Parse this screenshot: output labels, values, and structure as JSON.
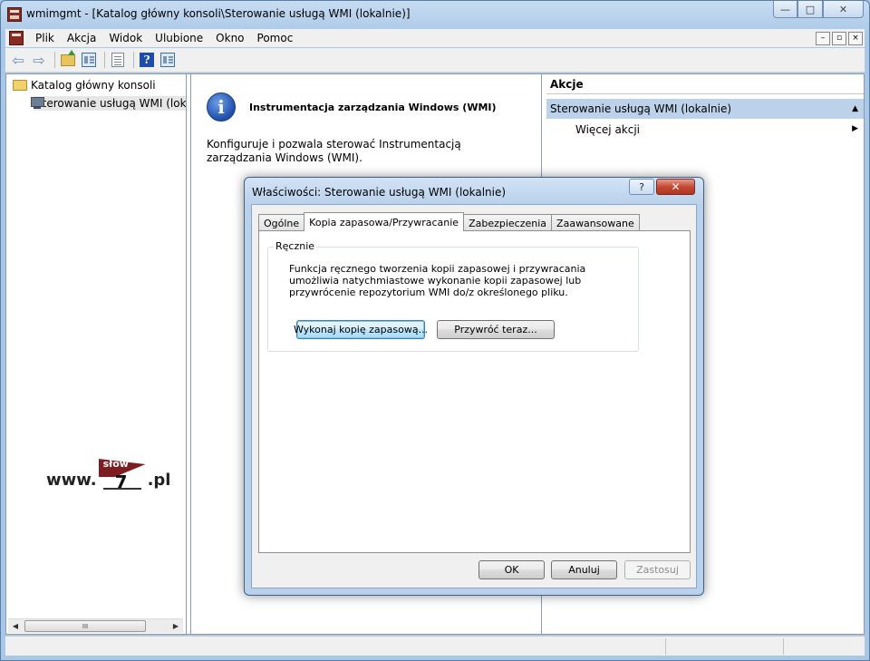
{
  "window": {
    "title": "wmimgmt - [Katalog główny konsoli\\Sterowanie usługą WMI (lokalnie)]",
    "controls": {
      "minimize": "—",
      "maximize": "□",
      "close": "✕"
    }
  },
  "menubar": {
    "items": [
      "Plik",
      "Akcja",
      "Widok",
      "Ulubione",
      "Okno",
      "Pomoc"
    ],
    "mdi_controls": [
      "–",
      "▫",
      "×"
    ]
  },
  "toolbar": {
    "back": "⇦",
    "forward": "⇨",
    "help": "?"
  },
  "tree": {
    "root": "Katalog główny konsoli",
    "child": "Sterowanie usługą WMI (lokalnie)",
    "scroll_thumb": "III",
    "scroll_left": "◀",
    "scroll_right": "▶"
  },
  "logo": {
    "prefix": "www.",
    "flag_text": "słow",
    "number": "7",
    "suffix": ".pl"
  },
  "middle": {
    "icon": "i",
    "title": "Instrumentacja zarządzania Windows (WMI)",
    "description": "Konfiguruje i pozwala sterować Instrumentacją zarządzania Windows (WMI)."
  },
  "actions": {
    "header": "Akcje",
    "section": "Sterowanie usługą WMI (lokalnie)",
    "section_toggle": "▲",
    "more": "Więcej akcji",
    "more_arrow": "▶"
  },
  "dialog": {
    "title": "Właściwości: Sterowanie usługą WMI (lokalnie)",
    "help": "?",
    "close": "✕",
    "tabs": [
      "Ogólne",
      "Kopia zapasowa/Przywracanie",
      "Zabezpieczenia",
      "Zaawansowane"
    ],
    "active_tab": 1,
    "group": {
      "label": "Ręcznie",
      "text": "Funkcja ręcznego tworzenia kopii zapasowej i przywracania umożliwia natychmiastowe wykonanie kopii zapasowej lub przywrócenie repozytorium WMI do/z określonego pliku.",
      "backup_button": "Wykonaj kopię zapasową...",
      "restore_button": "Przywróć teraz..."
    },
    "ok": "OK",
    "cancel": "Anuluj",
    "apply": "Zastosuj"
  }
}
